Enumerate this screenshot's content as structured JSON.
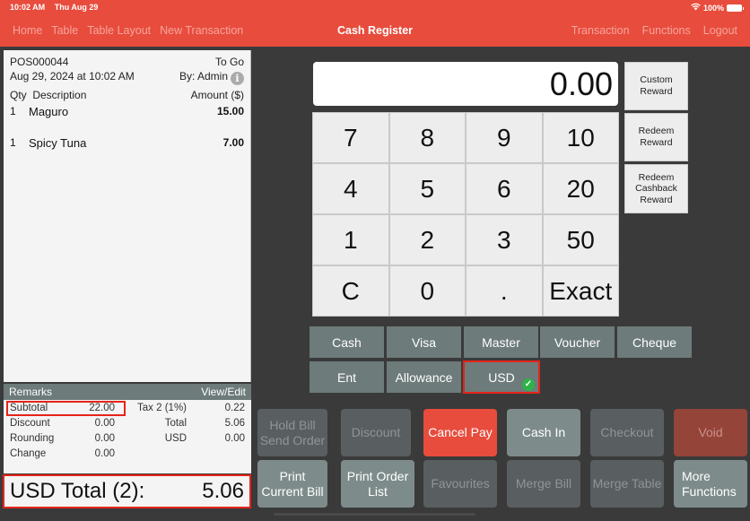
{
  "status_bar": {
    "time": "10:02 AM",
    "date": "Thu Aug 29",
    "battery": "100%",
    "wifi_icon": "wifi-icon",
    "battery_icon": "battery-icon"
  },
  "nav": {
    "left": [
      "Home",
      "Table",
      "Table Layout",
      "New Transaction"
    ],
    "title": "Cash Register",
    "right": [
      "Transaction",
      "Functions",
      "Logout"
    ]
  },
  "receipt": {
    "order_id": "POS000044",
    "order_type": "To Go",
    "datetime": "Aug 29, 2024 at 10:02 AM",
    "by": "By: Admin",
    "info_icon": "i",
    "headers": {
      "qty": "Qty",
      "description": "Description",
      "amount": "Amount ($)"
    },
    "items": [
      {
        "qty": "1",
        "description": "Maguro",
        "amount": "15.00"
      },
      {
        "qty": "1",
        "description": "Spicy Tuna",
        "amount": "7.00"
      }
    ]
  },
  "remarks": {
    "label": "Remarks",
    "action": "View/Edit"
  },
  "summary": {
    "subtotal_label": "Subtotal",
    "subtotal": "22.00",
    "discount_label": "Discount",
    "discount": "0.00",
    "rounding_label": "Rounding",
    "rounding": "0.00",
    "change_label": "Change",
    "change": "0.00",
    "tax_label": "Tax 2 (1%)",
    "tax": "0.22",
    "total_label": "Total",
    "total": "5.06",
    "usd_label": "USD",
    "usd": "0.00"
  },
  "grand_total": {
    "label": "USD Total (2):",
    "value": "5.06"
  },
  "display": {
    "value": "0.00"
  },
  "keypad": [
    "7",
    "8",
    "9",
    "10",
    "4",
    "5",
    "6",
    "20",
    "1",
    "2",
    "3",
    "50",
    "C",
    "0",
    ".",
    "Exact"
  ],
  "rewards": [
    "Custom Reward",
    "Redeem Reward",
    "Redeem Cashback Reward"
  ],
  "payment_methods": [
    "Cash",
    "Visa",
    "Master",
    "Voucher",
    "Cheque",
    "Ent",
    "Allowance",
    "USD"
  ],
  "selected_payment": "USD",
  "actions": [
    {
      "label": "Hold Bill Send Order",
      "state": "disabled"
    },
    {
      "label": "Discount",
      "state": "disabled"
    },
    {
      "label": "Cancel Pay",
      "state": "active"
    },
    {
      "label": "Cash In",
      "state": "enabled"
    },
    {
      "label": "Checkout",
      "state": "disabled"
    },
    {
      "label": "Void",
      "state": "disabled"
    },
    {
      "label": "Print Current Bill",
      "state": "enabled"
    },
    {
      "label": "Print Order List",
      "state": "enabled"
    },
    {
      "label": "Favourites",
      "state": "disabled"
    },
    {
      "label": "Merge Bill",
      "state": "disabled"
    },
    {
      "label": "Merge Table",
      "state": "disabled"
    },
    {
      "label": "More Functions",
      "state": "enabled"
    }
  ],
  "colors": {
    "brand": "#e84c3d",
    "payment_button": "#6d7b7a",
    "selected_border": "#e5241a",
    "check": "#2db34a"
  }
}
